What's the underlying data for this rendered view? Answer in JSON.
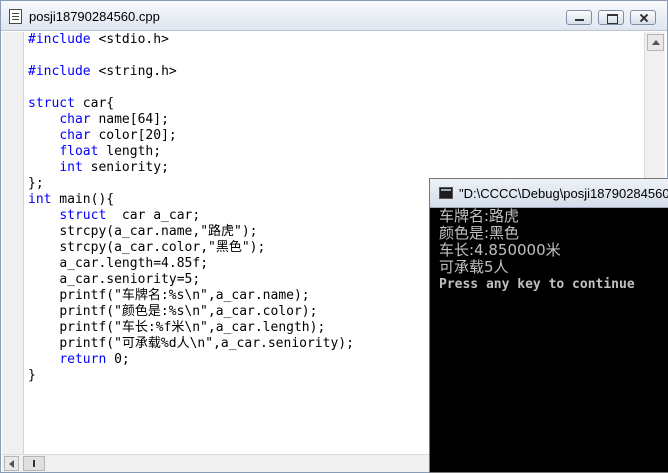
{
  "editor": {
    "title": "posji18790284560.cpp",
    "code_lines": [
      {
        "kw": "#include",
        "rest": " <stdio.h>"
      },
      {
        "kw": "",
        "rest": ""
      },
      {
        "kw": "#include",
        "rest": " <string.h>"
      },
      {
        "kw": "",
        "rest": ""
      },
      {
        "kw": "struct",
        "rest": " car{"
      },
      {
        "indent": "    ",
        "kw": "char",
        "rest": " name[64];"
      },
      {
        "indent": "    ",
        "kw": "char",
        "rest": " color[20];"
      },
      {
        "indent": "    ",
        "kw": "float",
        "rest": " length;"
      },
      {
        "indent": "    ",
        "kw": "int",
        "rest": " seniority;"
      },
      {
        "kw": "",
        "rest": "};"
      },
      {
        "kw": "int",
        "rest": " main(){"
      },
      {
        "indent": "    ",
        "kw": "struct",
        "rest": "  car a_car;"
      },
      {
        "indent": "    ",
        "kw": "",
        "rest": "strcpy(a_car.name,\"路虎\");"
      },
      {
        "indent": "    ",
        "kw": "",
        "rest": "strcpy(a_car.color,\"黑色\");"
      },
      {
        "indent": "    ",
        "kw": "",
        "rest": "a_car.length=4.85f;"
      },
      {
        "indent": "    ",
        "kw": "",
        "rest": "a_car.seniority=5;"
      },
      {
        "indent": "    ",
        "kw": "",
        "rest": "printf(\"车牌名:%s\\n\",a_car.name);"
      },
      {
        "indent": "    ",
        "kw": "",
        "rest": "printf(\"颜色是:%s\\n\",a_car.color);"
      },
      {
        "indent": "    ",
        "kw": "",
        "rest": "printf(\"车长:%f米\\n\",a_car.length);"
      },
      {
        "indent": "    ",
        "kw": "",
        "rest": "printf(\"可承载%d人\\n\",a_car.seniority);"
      },
      {
        "indent": "    ",
        "kw": "return",
        "rest": " 0;"
      },
      {
        "kw": "",
        "rest": "}"
      }
    ]
  },
  "console": {
    "title": "\"D:\\CCCC\\Debug\\posji18790284560",
    "lines": [
      "车牌名:路虎",
      "颜色是:黑色",
      "车长:4.850000米",
      "可承载5人"
    ],
    "prompt": "Press any key to continue"
  },
  "colors": {
    "keyword": "#0000ff",
    "console_text": "#c0c0c0",
    "console_bg": "#000000"
  },
  "icons": [
    "document-icon",
    "minimize-icon",
    "maximize-icon",
    "close-icon",
    "console-app-icon",
    "scroll-up-arrow-icon",
    "scroll-left-arrow-icon"
  ]
}
